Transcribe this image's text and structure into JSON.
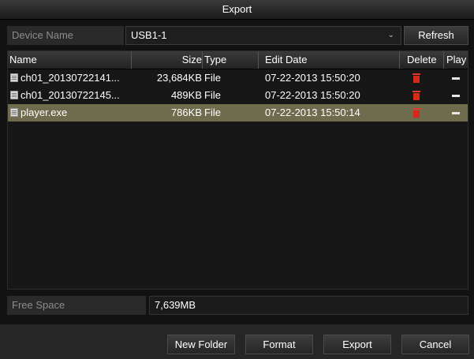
{
  "dialog": {
    "title": "Export"
  },
  "device": {
    "label": "Device Name",
    "selected": "USB1-1",
    "refresh_label": "Refresh"
  },
  "table": {
    "columns": {
      "name": "Name",
      "size": "Size",
      "type": "Type",
      "edit_date": "Edit Date",
      "delete": "Delete",
      "play": "Play"
    },
    "rows": [
      {
        "name": "ch01_20130722141...",
        "size": "23,684KB",
        "type": "File",
        "edit_date": "07-22-2013 15:50:20"
      },
      {
        "name": "ch01_20130722145...",
        "size": "489KB",
        "type": "File",
        "edit_date": "07-22-2013 15:50:20"
      },
      {
        "name": "player.exe",
        "size": "786KB",
        "type": "File",
        "edit_date": "07-22-2013 15:50:14"
      }
    ],
    "selected_row": 2
  },
  "free_space": {
    "label": "Free Space",
    "value": "7,639MB"
  },
  "footer": {
    "new_folder_label": "New Folder",
    "format_label": "Format",
    "export_label": "Export",
    "cancel_label": "Cancel"
  },
  "colors": {
    "selected_row": "#6e6c4d",
    "delete_icon": "#d52a1a"
  }
}
